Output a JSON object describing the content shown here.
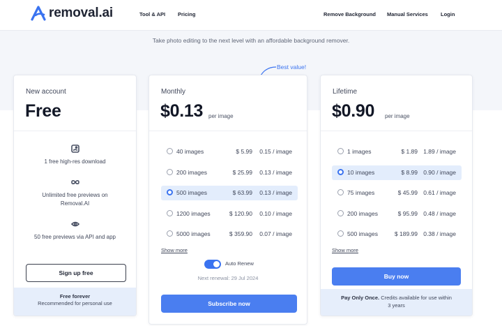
{
  "brand": {
    "name": "removal.ai",
    "accent": "#3a73f0"
  },
  "nav": {
    "left": [
      "Tool & API",
      "Pricing"
    ],
    "right": [
      "Remove Background",
      "Manual Services",
      "Login"
    ]
  },
  "tagline": "Take photo editing to the next level with an affordable background remover.",
  "best_value": "Best value!",
  "free_plan": {
    "title": "New account",
    "price": "Free",
    "features": [
      {
        "icon": "image-icon",
        "text": "1 free high-res download"
      },
      {
        "icon": "infinity-icon",
        "text": "Unlimited free previews on Removal.AI"
      },
      {
        "icon": "eye-icon",
        "text": "50 free previews via API and app"
      }
    ],
    "button": "Sign up free",
    "footer_title": "Free forever",
    "footer_sub": "Recommended for personal use"
  },
  "monthly_plan": {
    "title": "Monthly",
    "price": "$0.13",
    "per": "per image",
    "options": [
      {
        "count": "40 images",
        "price": "$ 5.99",
        "per": "0.15 / image",
        "selected": false
      },
      {
        "count": "200 images",
        "price": "$ 25.99",
        "per": "0.13 / image",
        "selected": false
      },
      {
        "count": "500 images",
        "price": "$ 63.99",
        "per": "0.13 / image",
        "selected": true
      },
      {
        "count": "1200 images",
        "price": "$ 120.90",
        "per": "0.10 / image",
        "selected": false
      },
      {
        "count": "5000 images",
        "price": "$ 359.90",
        "per": "0.07 / image",
        "selected": false
      }
    ],
    "show_more": "Show more",
    "auto_renew_label": "Auto Renew",
    "auto_renew_on": true,
    "next_renewal": "Next renewal:  29 Jul 2024",
    "button": "Subscribe now"
  },
  "lifetime_plan": {
    "title": "Lifetime",
    "price": "$0.90",
    "per": "per image",
    "options": [
      {
        "count": "1 images",
        "price": "$ 1.89",
        "per": "1.89 / image",
        "selected": false
      },
      {
        "count": "10 images",
        "price": "$ 8.99",
        "per": "0.90 / image",
        "selected": true
      },
      {
        "count": "75 images",
        "price": "$ 45.99",
        "per": "0.61 / image",
        "selected": false
      },
      {
        "count": "200 images",
        "price": "$ 95.99",
        "per": "0.48 / image",
        "selected": false
      },
      {
        "count": "500 images",
        "price": "$ 189.99",
        "per": "0.38 / image",
        "selected": false
      }
    ],
    "show_more": "Show more",
    "button": "Buy now",
    "footer_bold": "Pay Only Once.",
    "footer_rest": " Credits available for use within 3 years"
  }
}
